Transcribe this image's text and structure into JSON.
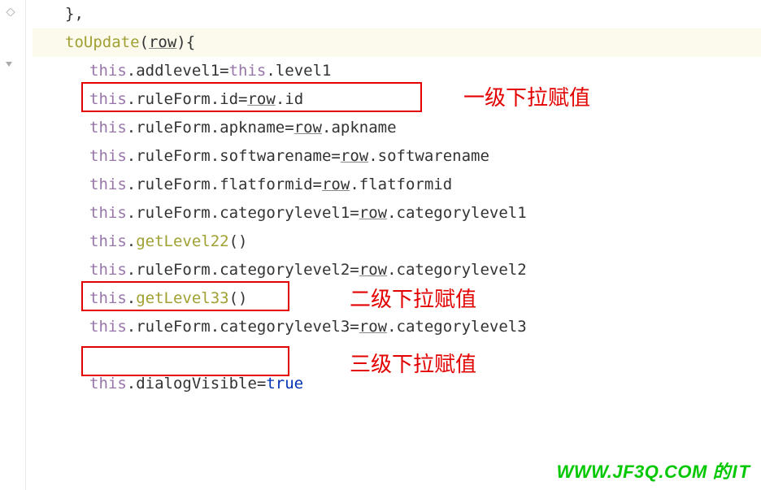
{
  "code": {
    "line1": "},",
    "line2_fn": "toUpdate",
    "line2_param": "row",
    "line3_a": "this",
    "line3_b": ".addlevel1=",
    "line3_c": "this",
    "line3_d": ".level1",
    "line4_a": "this",
    "line4_b": ".ruleForm.id=",
    "line4_c": "row",
    "line4_d": ".id",
    "line5_a": "this",
    "line5_b": ".ruleForm.apkname=",
    "line5_c": "row",
    "line5_d": ".apkname",
    "line6_a": "this",
    "line6_b": ".ruleForm.softwarename=",
    "line6_c": "row",
    "line6_d": ".softwarename",
    "line7_a": "this",
    "line7_b": ".ruleForm.flatformid=",
    "line7_c": "row",
    "line7_d": ".flatformid",
    "line8_a": "this",
    "line8_b": ".ruleForm.categorylevel1=",
    "line8_c": "row",
    "line8_d": ".categorylevel1",
    "line9_a": "this",
    "line9_b": ".",
    "line9_c": "getLevel22",
    "line9_d": "()",
    "line10_a": "this",
    "line10_b": ".ruleForm.categorylevel2=",
    "line10_c": "row",
    "line10_d": ".categorylevel2",
    "line11_a": "this",
    "line11_b": ".",
    "line11_c": "getLevel33",
    "line11_d": "()",
    "line12_a": "this",
    "line12_b": ".ruleForm.categorylevel3=",
    "line12_c": "row",
    "line12_d": ".categorylevel3",
    "line14_a": "this",
    "line14_b": ".dialogVisible=",
    "line14_c": "true"
  },
  "annotations": {
    "a1": "一级下拉赋值",
    "a2": "二级下拉赋值",
    "a3": "三级下拉赋值"
  },
  "watermark": {
    "text": "WWW.JF3Q.COM",
    "suffix": "的IT"
  }
}
